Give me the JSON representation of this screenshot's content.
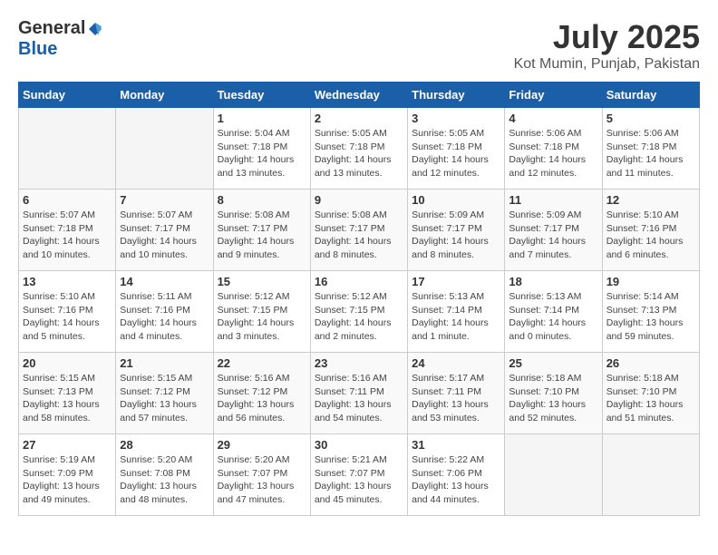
{
  "logo": {
    "general": "General",
    "blue": "Blue"
  },
  "header": {
    "month": "July 2025",
    "location": "Kot Mumin, Punjab, Pakistan"
  },
  "weekdays": [
    "Sunday",
    "Monday",
    "Tuesday",
    "Wednesday",
    "Thursday",
    "Friday",
    "Saturday"
  ],
  "weeks": [
    [
      {
        "day": null
      },
      {
        "day": null
      },
      {
        "day": "1",
        "sunrise": "Sunrise: 5:04 AM",
        "sunset": "Sunset: 7:18 PM",
        "daylight": "Daylight: 14 hours and 13 minutes."
      },
      {
        "day": "2",
        "sunrise": "Sunrise: 5:05 AM",
        "sunset": "Sunset: 7:18 PM",
        "daylight": "Daylight: 14 hours and 13 minutes."
      },
      {
        "day": "3",
        "sunrise": "Sunrise: 5:05 AM",
        "sunset": "Sunset: 7:18 PM",
        "daylight": "Daylight: 14 hours and 12 minutes."
      },
      {
        "day": "4",
        "sunrise": "Sunrise: 5:06 AM",
        "sunset": "Sunset: 7:18 PM",
        "daylight": "Daylight: 14 hours and 12 minutes."
      },
      {
        "day": "5",
        "sunrise": "Sunrise: 5:06 AM",
        "sunset": "Sunset: 7:18 PM",
        "daylight": "Daylight: 14 hours and 11 minutes."
      }
    ],
    [
      {
        "day": "6",
        "sunrise": "Sunrise: 5:07 AM",
        "sunset": "Sunset: 7:18 PM",
        "daylight": "Daylight: 14 hours and 10 minutes."
      },
      {
        "day": "7",
        "sunrise": "Sunrise: 5:07 AM",
        "sunset": "Sunset: 7:17 PM",
        "daylight": "Daylight: 14 hours and 10 minutes."
      },
      {
        "day": "8",
        "sunrise": "Sunrise: 5:08 AM",
        "sunset": "Sunset: 7:17 PM",
        "daylight": "Daylight: 14 hours and 9 minutes."
      },
      {
        "day": "9",
        "sunrise": "Sunrise: 5:08 AM",
        "sunset": "Sunset: 7:17 PM",
        "daylight": "Daylight: 14 hours and 8 minutes."
      },
      {
        "day": "10",
        "sunrise": "Sunrise: 5:09 AM",
        "sunset": "Sunset: 7:17 PM",
        "daylight": "Daylight: 14 hours and 8 minutes."
      },
      {
        "day": "11",
        "sunrise": "Sunrise: 5:09 AM",
        "sunset": "Sunset: 7:17 PM",
        "daylight": "Daylight: 14 hours and 7 minutes."
      },
      {
        "day": "12",
        "sunrise": "Sunrise: 5:10 AM",
        "sunset": "Sunset: 7:16 PM",
        "daylight": "Daylight: 14 hours and 6 minutes."
      }
    ],
    [
      {
        "day": "13",
        "sunrise": "Sunrise: 5:10 AM",
        "sunset": "Sunset: 7:16 PM",
        "daylight": "Daylight: 14 hours and 5 minutes."
      },
      {
        "day": "14",
        "sunrise": "Sunrise: 5:11 AM",
        "sunset": "Sunset: 7:16 PM",
        "daylight": "Daylight: 14 hours and 4 minutes."
      },
      {
        "day": "15",
        "sunrise": "Sunrise: 5:12 AM",
        "sunset": "Sunset: 7:15 PM",
        "daylight": "Daylight: 14 hours and 3 minutes."
      },
      {
        "day": "16",
        "sunrise": "Sunrise: 5:12 AM",
        "sunset": "Sunset: 7:15 PM",
        "daylight": "Daylight: 14 hours and 2 minutes."
      },
      {
        "day": "17",
        "sunrise": "Sunrise: 5:13 AM",
        "sunset": "Sunset: 7:14 PM",
        "daylight": "Daylight: 14 hours and 1 minute."
      },
      {
        "day": "18",
        "sunrise": "Sunrise: 5:13 AM",
        "sunset": "Sunset: 7:14 PM",
        "daylight": "Daylight: 14 hours and 0 minutes."
      },
      {
        "day": "19",
        "sunrise": "Sunrise: 5:14 AM",
        "sunset": "Sunset: 7:13 PM",
        "daylight": "Daylight: 13 hours and 59 minutes."
      }
    ],
    [
      {
        "day": "20",
        "sunrise": "Sunrise: 5:15 AM",
        "sunset": "Sunset: 7:13 PM",
        "daylight": "Daylight: 13 hours and 58 minutes."
      },
      {
        "day": "21",
        "sunrise": "Sunrise: 5:15 AM",
        "sunset": "Sunset: 7:12 PM",
        "daylight": "Daylight: 13 hours and 57 minutes."
      },
      {
        "day": "22",
        "sunrise": "Sunrise: 5:16 AM",
        "sunset": "Sunset: 7:12 PM",
        "daylight": "Daylight: 13 hours and 56 minutes."
      },
      {
        "day": "23",
        "sunrise": "Sunrise: 5:16 AM",
        "sunset": "Sunset: 7:11 PM",
        "daylight": "Daylight: 13 hours and 54 minutes."
      },
      {
        "day": "24",
        "sunrise": "Sunrise: 5:17 AM",
        "sunset": "Sunset: 7:11 PM",
        "daylight": "Daylight: 13 hours and 53 minutes."
      },
      {
        "day": "25",
        "sunrise": "Sunrise: 5:18 AM",
        "sunset": "Sunset: 7:10 PM",
        "daylight": "Daylight: 13 hours and 52 minutes."
      },
      {
        "day": "26",
        "sunrise": "Sunrise: 5:18 AM",
        "sunset": "Sunset: 7:10 PM",
        "daylight": "Daylight: 13 hours and 51 minutes."
      }
    ],
    [
      {
        "day": "27",
        "sunrise": "Sunrise: 5:19 AM",
        "sunset": "Sunset: 7:09 PM",
        "daylight": "Daylight: 13 hours and 49 minutes."
      },
      {
        "day": "28",
        "sunrise": "Sunrise: 5:20 AM",
        "sunset": "Sunset: 7:08 PM",
        "daylight": "Daylight: 13 hours and 48 minutes."
      },
      {
        "day": "29",
        "sunrise": "Sunrise: 5:20 AM",
        "sunset": "Sunset: 7:07 PM",
        "daylight": "Daylight: 13 hours and 47 minutes."
      },
      {
        "day": "30",
        "sunrise": "Sunrise: 5:21 AM",
        "sunset": "Sunset: 7:07 PM",
        "daylight": "Daylight: 13 hours and 45 minutes."
      },
      {
        "day": "31",
        "sunrise": "Sunrise: 5:22 AM",
        "sunset": "Sunset: 7:06 PM",
        "daylight": "Daylight: 13 hours and 44 minutes."
      },
      {
        "day": null
      },
      {
        "day": null
      }
    ]
  ]
}
